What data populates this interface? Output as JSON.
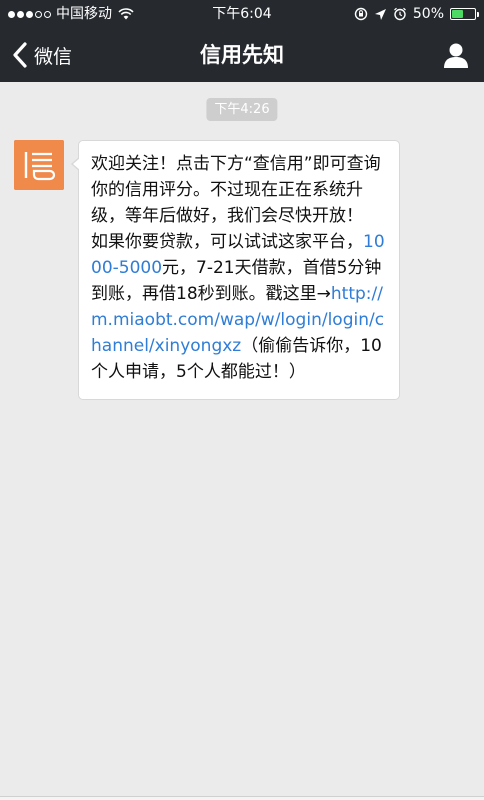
{
  "status_bar": {
    "carrier": "中国移动",
    "time": "下午6:04",
    "battery_percent": "50%",
    "battery_level": 0.5,
    "battery_color": "#4cd964"
  },
  "nav": {
    "back_label": "微信",
    "title": "信用先知",
    "profile_icon": "person-icon"
  },
  "chat": {
    "timestamp": "下午4:26",
    "avatar_icon": "xin-logo-icon",
    "message": {
      "p1": "欢迎关注！点击下方“查信用”即可查询你的信用评分。不过现在正在系统升级，等年后做好，我们会尽快开放！",
      "p2a": "如果你要贷款，可以试试这家平台，",
      "p2_amount": "1000-5000",
      "p2b": "元，7-21天借款，首借5分钟到账，再借18秒到账。戳这里→",
      "link": "http://m.miaobt.com/wap/w/login/login/channel/xinyongxz",
      "p2c": "（偷偷告诉你，10个人申请，5个人都能过！）"
    }
  },
  "colors": {
    "bar_bg": "#262a2f",
    "chat_bg": "#ebebeb",
    "link": "#2f7dd6",
    "avatar_bg": "#f08a4b"
  }
}
